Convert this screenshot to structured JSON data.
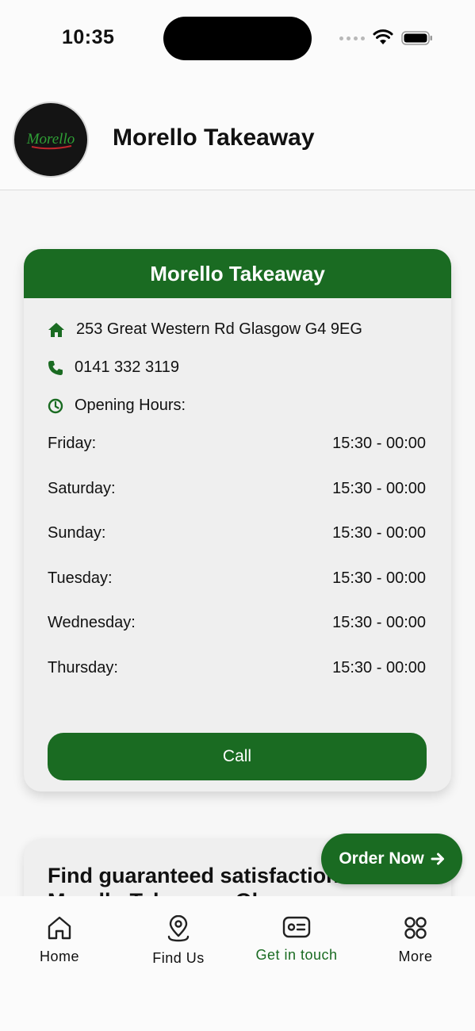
{
  "status_bar": {
    "time": "10:35"
  },
  "header": {
    "title": "Morello Takeaway",
    "logo_text": "Morello"
  },
  "info_card": {
    "title": "Morello Takeaway",
    "address": "253 Great Western Rd Glasgow G4 9EG",
    "phone": "0141 332 3119",
    "opening_label": "Opening Hours:",
    "hours": [
      {
        "day": "Friday:",
        "time": "15:30 - 00:00"
      },
      {
        "day": "Saturday:",
        "time": "15:30 - 00:00"
      },
      {
        "day": "Sunday:",
        "time": "15:30 - 00:00"
      },
      {
        "day": "Tuesday:",
        "time": "15:30 - 00:00"
      },
      {
        "day": "Wednesday:",
        "time": "15:30 - 00:00"
      },
      {
        "day": "Thursday:",
        "time": "15:30 - 00:00"
      }
    ],
    "call_label": "Call"
  },
  "promo_card": {
    "text": "Find guaranteed satisfaction at Morello Takeaway Glasgow"
  },
  "order_button": {
    "label": "Order Now"
  },
  "nav": [
    {
      "label": "Home",
      "icon": "home-icon"
    },
    {
      "label": "Find Us",
      "icon": "location-icon"
    },
    {
      "label": "Get in touch",
      "icon": "contact-card-icon"
    },
    {
      "label": "More",
      "icon": "grid-icon"
    }
  ],
  "colors": {
    "brand_green": "#1a6b22",
    "card_bg": "#efefef",
    "page_bg": "#f7f7f7"
  }
}
